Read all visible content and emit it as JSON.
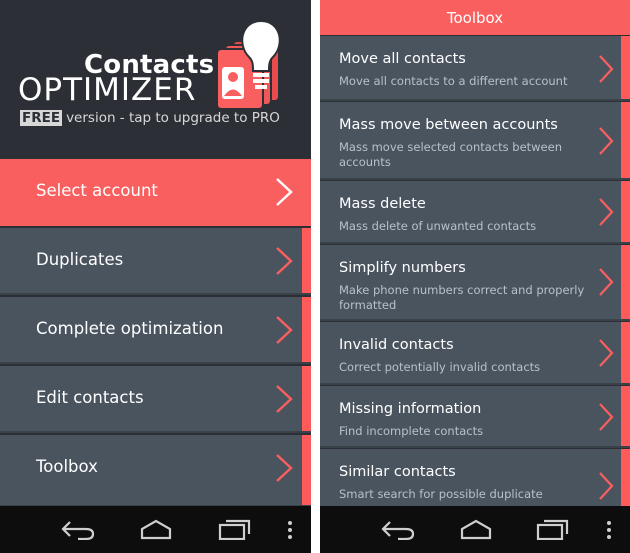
{
  "left": {
    "logo": {
      "line1": "Contacts",
      "line2": "OPTIMIZER",
      "free": "FREE",
      "subtitle": "version  -  tap to upgrade to PRO"
    },
    "menu": [
      {
        "label": "Select account",
        "selected": true
      },
      {
        "label": "Duplicates"
      },
      {
        "label": "Complete optimization"
      },
      {
        "label": "Edit contacts"
      },
      {
        "label": "Toolbox"
      }
    ]
  },
  "right": {
    "header": {
      "title": "Toolbox"
    },
    "tools": [
      {
        "title": "Move all contacts",
        "desc": "Move all contacts to a different account"
      },
      {
        "title": "Mass move between accounts",
        "desc": "Mass move selected contacts between accounts"
      },
      {
        "title": "Mass delete",
        "desc": "Mass delete of unwanted contacts"
      },
      {
        "title": "Simplify numbers",
        "desc": "Make phone numbers correct and properly formatted"
      },
      {
        "title": "Invalid contacts",
        "desc": "Correct potentially invalid contacts"
      },
      {
        "title": "Missing information",
        "desc": "Find incomplete contacts"
      },
      {
        "title": "Similar contacts",
        "desc": "Smart search for possible duplicate"
      }
    ]
  },
  "colors": {
    "accent": "#fa5f5f",
    "item_bg": "#4a545f",
    "dark_bg": "#2c3036"
  },
  "icons": {
    "back": "back-icon",
    "home": "home-icon",
    "recents": "recent-apps-icon",
    "overflow": "overflow-menu-icon",
    "chevron": "chevron-right-icon"
  }
}
